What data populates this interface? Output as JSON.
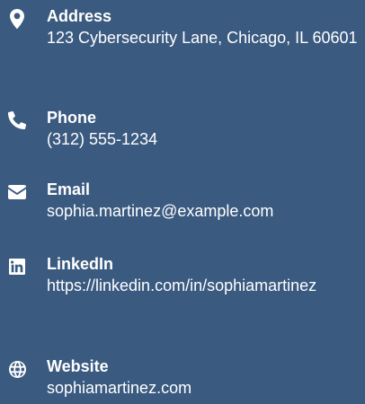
{
  "contact": {
    "items": [
      {
        "icon": "map-marker-icon",
        "label": "Address",
        "value": "123 Cybersecurity Lane, Chicago, IL 60601"
      },
      {
        "icon": "phone-icon",
        "label": "Phone",
        "value": "(312) 555-1234"
      },
      {
        "icon": "envelope-icon",
        "label": "Email",
        "value": "sophia.martinez@example.com"
      },
      {
        "icon": "linkedin-icon",
        "label": "LinkedIn",
        "value": "https://linkedin.com/in/sophiamartinez"
      },
      {
        "icon": "globe-icon",
        "label": "Website",
        "value": "sophiamartinez.com"
      }
    ]
  },
  "colors": {
    "background": "#3a5a80",
    "text": "#ffffff"
  }
}
